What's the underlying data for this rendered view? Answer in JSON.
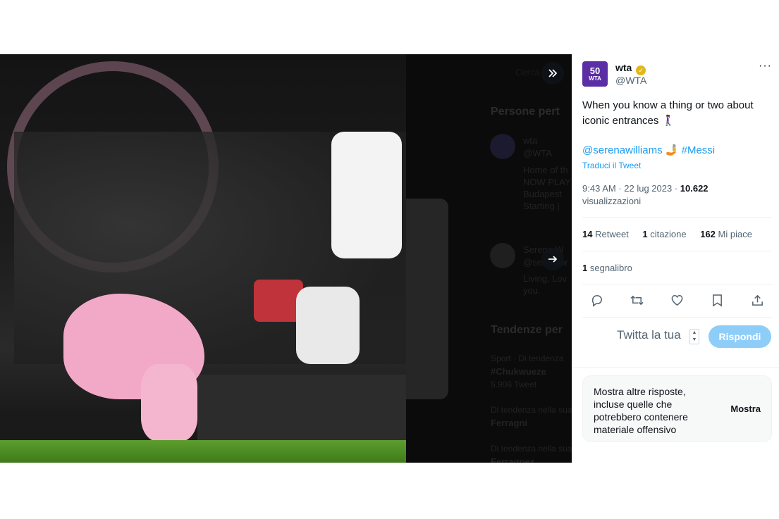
{
  "tweet": {
    "author_name": "wta",
    "author_handle": "@WTA",
    "avatar_text_top": "50",
    "avatar_text_bottom": "WTA",
    "text": "When you know a thing or two about iconic entrances 🚶🏾‍♀️",
    "mention": "@serenawilliams",
    "mention_emoji": "🤳",
    "hashtag": "#Messi",
    "translate_label": "Traduci il Tweet",
    "time": "9:43 AM · 22 lug 2023 · ",
    "views_count": "10.622",
    "views_label": "visualizzazioni",
    "retweets_count": "14",
    "retweets_label": "Retweet",
    "quotes_count": "1",
    "quotes_label": "citazione",
    "likes_count": "162",
    "likes_label": "Mi piace",
    "bookmarks_count": "1",
    "bookmarks_label": "segnalibro"
  },
  "reply": {
    "placeholder": "Twitta la tua",
    "button_label": "Rispondi"
  },
  "show_more": {
    "text": "Mostra altre risposte, incluse quelle che potrebbero contenere materiale offensivo",
    "button_label": "Mostra"
  },
  "background": {
    "search_placeholder": "Cerca",
    "section_people": "Persone pert",
    "people_name": "wta",
    "people_handle": "@WTA",
    "people_bio": "Home of th",
    "people_bio2": "NOW PLAY",
    "people_bio3": "Budapest",
    "people_bio4": "Starting |",
    "person2_name": "Serena W",
    "person2_handle": "@serenaw",
    "person2_bio": "Living, Lov",
    "person2_bio2": "you.",
    "section_trends": "Tendenze per",
    "trend1_context": "Sport · Di tendenza",
    "trend1_name": "#Chukwueze",
    "trend1_count": "5.908 Tweet",
    "trend2_context": "Di tendenza nella sua",
    "trend2_name": "Ferragni",
    "trend3_context": "Di tendenza nella sua",
    "trend3_name": "Ferragnez"
  },
  "colors": {
    "accent": "#1d9bf0",
    "reply_button": "#8ecdf8",
    "verified_badge": "#e2b719",
    "avatar_bg": "#5b2ea6"
  }
}
